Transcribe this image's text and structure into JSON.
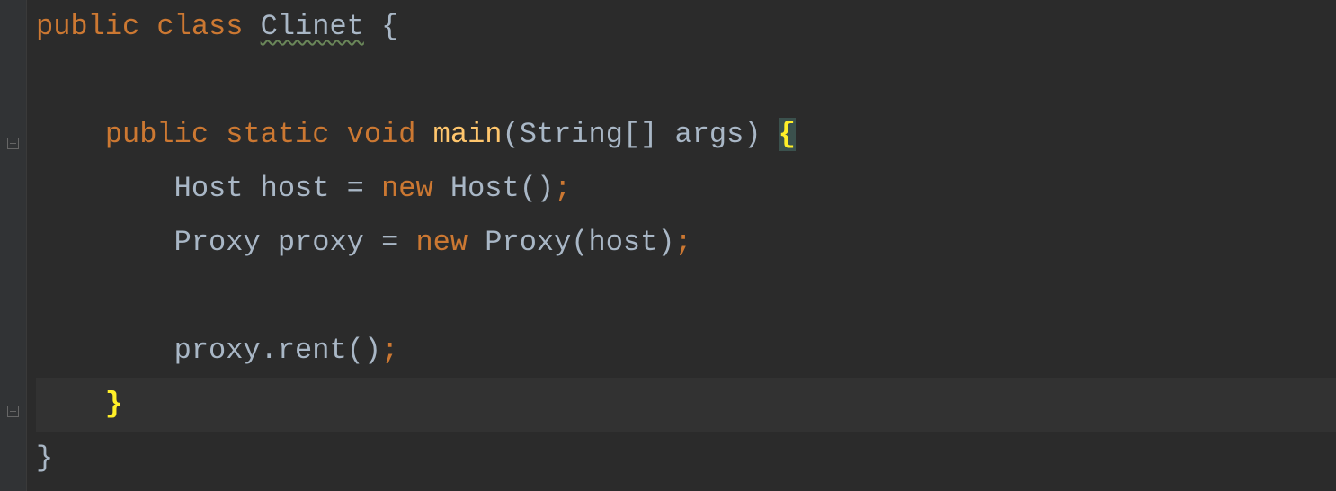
{
  "code": {
    "line1": {
      "kw_public": "public",
      "kw_class": "class",
      "classname": "Clinet",
      "brace": "{"
    },
    "line3": {
      "kw_public": "public",
      "kw_static": "static",
      "kw_void": "void",
      "method": "main",
      "params_open": "(",
      "param_type": "String[]",
      "param_name": "args",
      "params_close": ")",
      "brace": "{"
    },
    "line4": {
      "type": "Host",
      "var": "host",
      "eq": "=",
      "kw_new": "new",
      "ctor": "Host()",
      "semi": ";"
    },
    "line5": {
      "type": "Proxy",
      "var": "proxy",
      "eq": "=",
      "kw_new": "new",
      "ctor": "Proxy(",
      "arg": "host",
      "close": ")",
      "semi": ";"
    },
    "line7": {
      "obj": "proxy",
      "dot": ".",
      "call": "rent()",
      "semi": ";"
    },
    "line8": {
      "brace": "}"
    },
    "line9": {
      "brace": "}"
    }
  }
}
